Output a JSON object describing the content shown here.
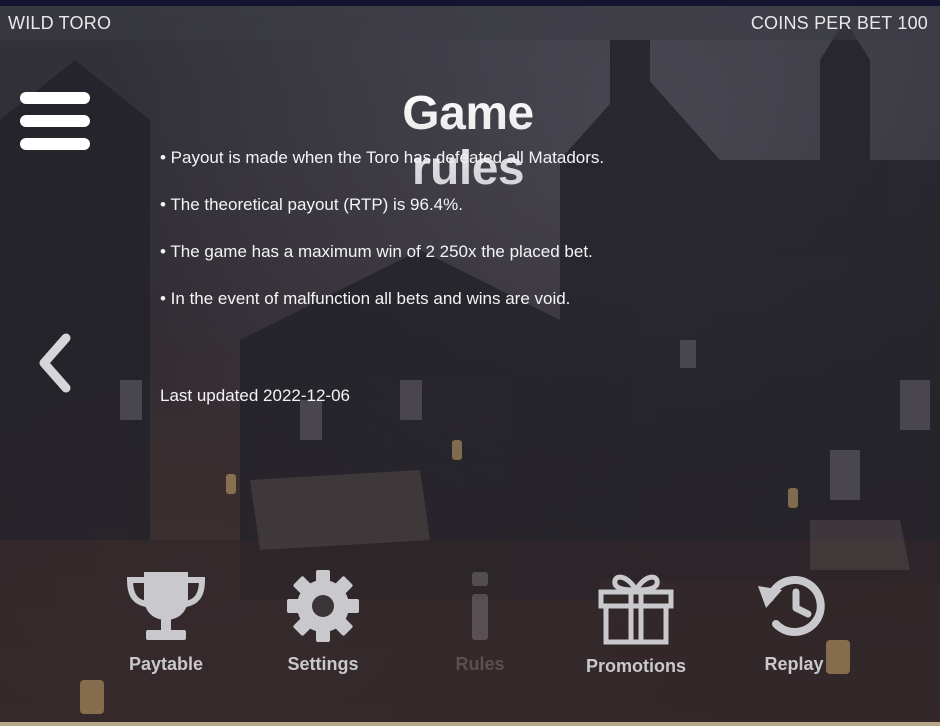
{
  "header": {
    "game_name": "WILD TORO",
    "coins_per_bet": "COINS PER BET 100"
  },
  "page": {
    "title": "Game rules",
    "rules": [
      "• Payout is made when the Toro has defeated all Matadors.",
      "• The theoretical payout (RTP) is 96.4%.",
      "• The game has a maximum win of 2 250x the placed bet.",
      "• In the event of malfunction all bets and wins are void."
    ],
    "last_updated": "Last updated 2022-12-06"
  },
  "nav": {
    "paytable": "Paytable",
    "settings": "Settings",
    "rules": "Rules",
    "promotions": "Promotions",
    "replay": "Replay",
    "active": "rules"
  },
  "icons": {
    "menu": "hamburger-icon",
    "back": "chevron-left-icon",
    "paytable": "trophy-icon",
    "settings": "gear-icon",
    "rules": "info-icon",
    "promotions": "gift-icon",
    "replay": "replay-icon"
  },
  "colors": {
    "header_bar": "#121430",
    "label": "#c9c9cd",
    "icon": "#c9c9cd"
  }
}
